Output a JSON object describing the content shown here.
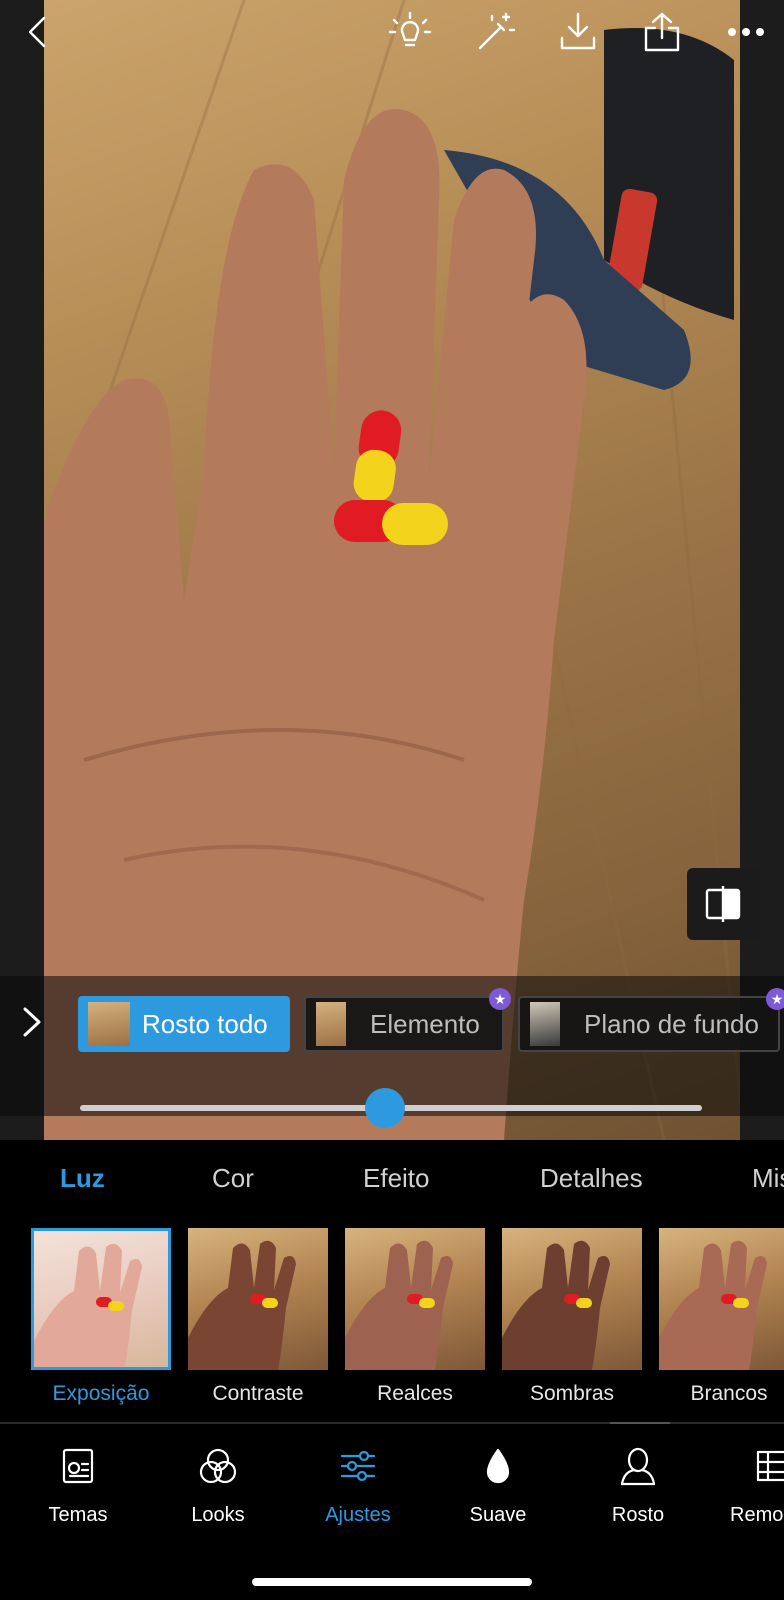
{
  "toolbar": {
    "back_icon": "chevron-left-icon",
    "items": [
      "lightbulb-icon",
      "magic-wand-icon",
      "download-icon",
      "share-icon",
      "more-icon"
    ]
  },
  "selection": {
    "expand_icon": "chevron-right-icon",
    "chips": [
      {
        "label": "Rosto todo",
        "active": true,
        "premium": false
      },
      {
        "label": "Elemento",
        "active": false,
        "premium": true
      },
      {
        "label": "Plano de fundo",
        "active": false,
        "premium": true
      }
    ]
  },
  "slider": {
    "value_fraction": 0.49,
    "accent": "#2d9ae0"
  },
  "categories": [
    "Luz",
    "Cor",
    "Efeito",
    "Detalhes",
    "Mis"
  ],
  "categories_selected": "Luz",
  "presets": [
    "Exposição",
    "Contraste",
    "Realces",
    "Sombras",
    "Brancos"
  ],
  "presets_selected": "Exposição",
  "nav": {
    "items": [
      {
        "label": "Temas",
        "icon": "themes-icon"
      },
      {
        "label": "Looks",
        "icon": "looks-icon"
      },
      {
        "label": "Ajustes",
        "icon": "adjustments-icon"
      },
      {
        "label": "Suave",
        "icon": "drop-icon"
      },
      {
        "label": "Rosto",
        "icon": "face-icon"
      },
      {
        "label": "Remo",
        "icon": "remove-icon"
      }
    ],
    "selected": "Ajustes"
  },
  "colors": {
    "accent": "#2d9ae0",
    "premium": "#7d5bd6",
    "background": "#000000"
  }
}
